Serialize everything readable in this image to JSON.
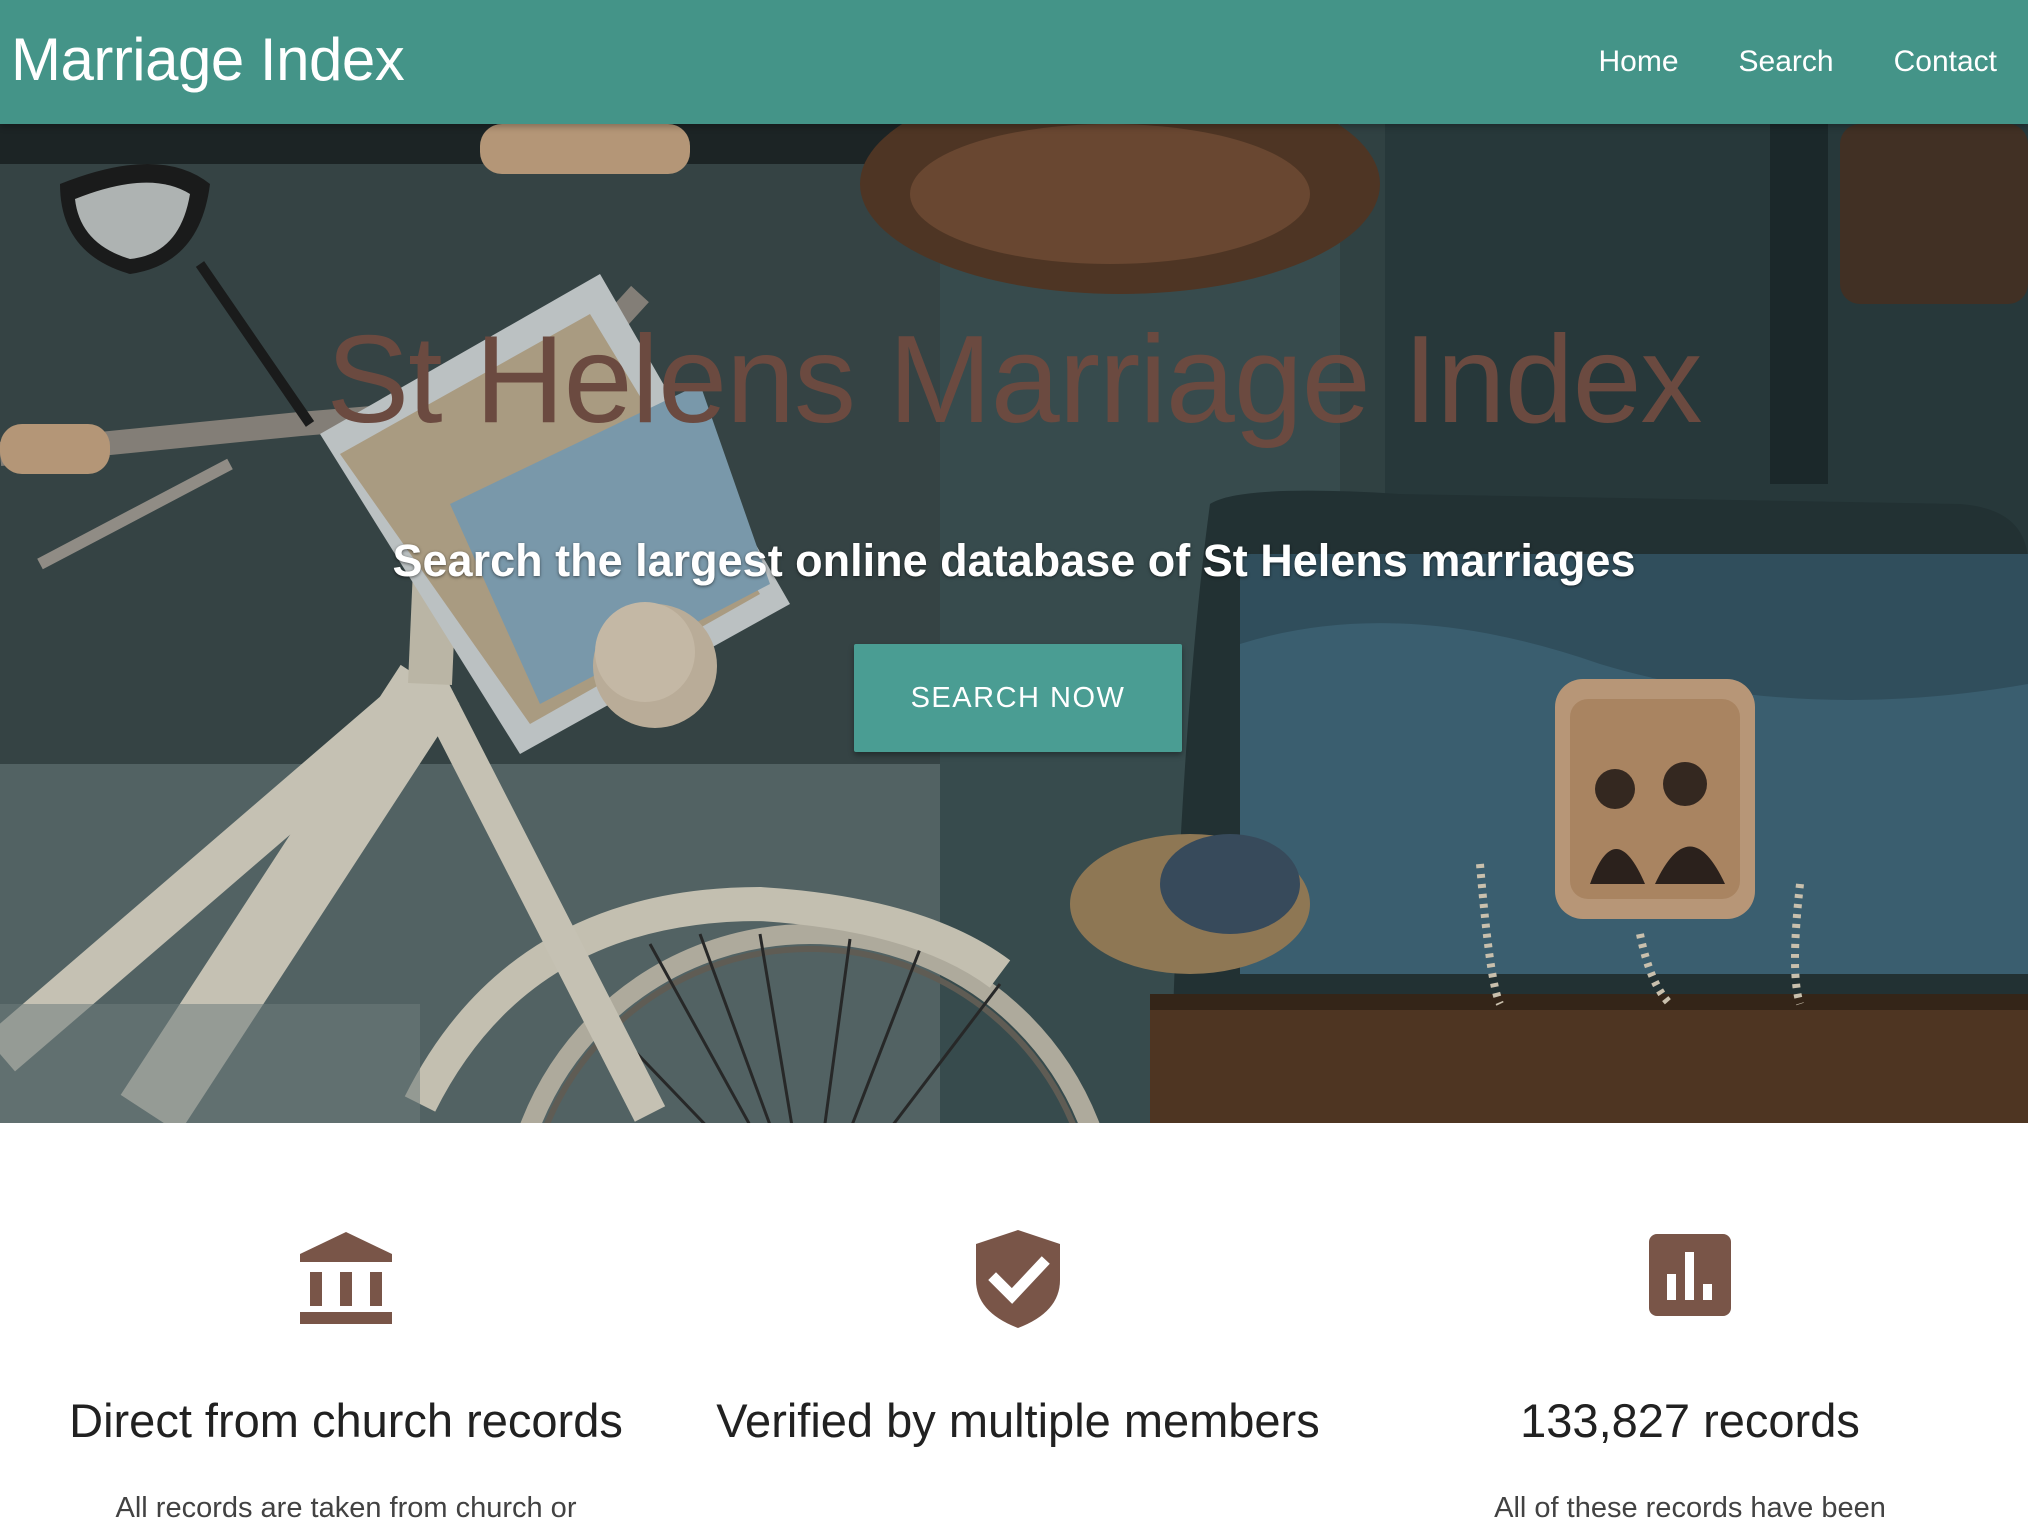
{
  "navbar": {
    "brand": "Marriage Index",
    "links": [
      "Home",
      "Search",
      "Contact"
    ]
  },
  "hero": {
    "title": "St Helens Marriage Index",
    "subtitle": "Search the largest online database of St Helens marriages",
    "button_label": "SEARCH NOW"
  },
  "features": [
    {
      "icon": "institution-icon",
      "title": "Direct from church records",
      "text": "All records are taken from church or"
    },
    {
      "icon": "verified-shield-icon",
      "title": "Verified by multiple members",
      "text": ""
    },
    {
      "icon": "bar-chart-icon",
      "title": "133,827 records",
      "text": "All of these records have been"
    }
  ],
  "colors": {
    "navbar": "#449488",
    "accent_button": "#4a9d93",
    "hero_title": "#6b4a40",
    "icon_brown": "#795548"
  }
}
